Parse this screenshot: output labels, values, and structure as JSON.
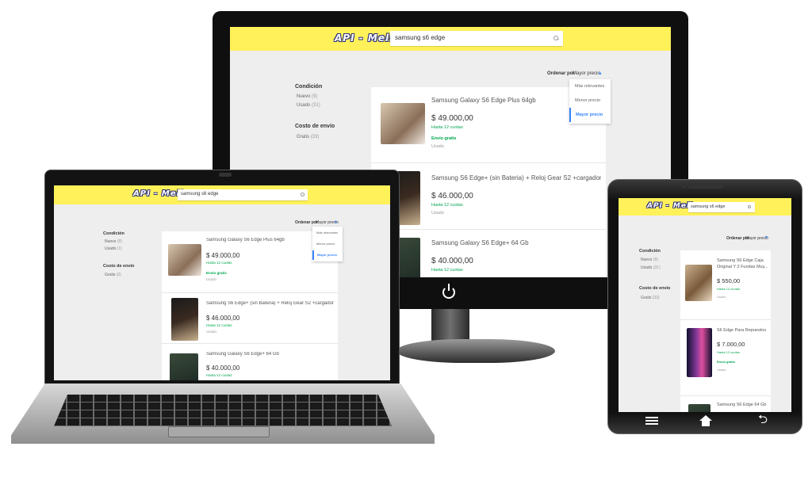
{
  "app": {
    "brand": "API - Meli",
    "search_value": "samsung s6 edge",
    "sort_label": "Ordenar por",
    "sort_value": "Mayor precio",
    "sort_options": [
      "Más relevantes",
      "Menor precio",
      "Mayor precio"
    ],
    "sort_options_laptop": [
      "Más relevantes",
      "Menor precio",
      "Mayor precio"
    ],
    "filters": {
      "condition_title": "Condición",
      "nuevo": "Nuevo",
      "nuevo_count": "(9)",
      "usado": "Usado",
      "usado_count": "(31)",
      "usado_count_laptop": "(1)",
      "shipping_title": "Costo de envío",
      "gratis": "Gratis",
      "gratis_count": "(33)",
      "gratis_count_laptop": "(0)"
    },
    "installments": "Hasta 12 cuotas",
    "free_shipping": "Envío gratis",
    "used": "Usado"
  },
  "monitor": {
    "products": [
      {
        "title": "Samsung Galaxy S6 Edge Plus 64gb",
        "price": "$ 49.000,00"
      },
      {
        "title": "Samsung S6 Edge+ (sin Bateria) + Reloj Gear S2 +cargador Ori",
        "price": "$ 46.000,00"
      },
      {
        "title": "Samsung Galaxy S6 Edge+ 64 Gb",
        "price": "$ 40.000,00"
      }
    ]
  },
  "laptop": {
    "products": [
      {
        "title": "Samsung Galaxy S6 Edge Plus 64gb",
        "price": "$ 49.000,00"
      },
      {
        "title": "Samsung S6 Edge+ (sin Bateria) + Reloj Gear S2 +cargador Ori",
        "price": "$ 46.000,00"
      },
      {
        "title": "Samsung Galaxy S6 Edge+ 64 Gb",
        "price": "$ 40.000,00"
      }
    ]
  },
  "tablet": {
    "products": [
      {
        "title_line1": "Samsung S6 Edge Caja",
        "title_line2": "Original Y 2 Fundas Muy...",
        "price": "$ 550,00"
      },
      {
        "title_line1": "S6 Edge Para Repuestos",
        "price": "$ 7.000,00"
      },
      {
        "title_line1": "Samsung S6 Edge 64 Gb"
      }
    ]
  },
  "colors": {
    "header_yellow": "#fff159",
    "accent_blue": "#3483fa",
    "green": "#00a650"
  },
  "icons": {
    "monitor_power": "power-icon",
    "tablet_menu": "menu-icon",
    "tablet_home": "home-icon",
    "tablet_back": "back-icon"
  }
}
